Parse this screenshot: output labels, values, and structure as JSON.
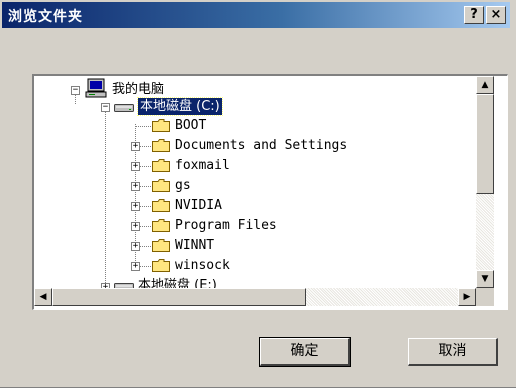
{
  "window": {
    "title": "浏览文件夹",
    "help_button": "?",
    "close_button": "×"
  },
  "tree": {
    "root": {
      "label": "我的电脑",
      "expander": "−"
    },
    "drive_c": {
      "label": "本地磁盘 (C:)",
      "expander": "−",
      "selected": true
    },
    "folders": [
      {
        "label": "BOOT",
        "expander": ""
      },
      {
        "label": "Documents and Settings",
        "expander": "+"
      },
      {
        "label": "foxmail",
        "expander": "+"
      },
      {
        "label": "gs",
        "expander": "+"
      },
      {
        "label": "NVIDIA",
        "expander": "+"
      },
      {
        "label": "Program Files",
        "expander": "+"
      },
      {
        "label": "WINNT",
        "expander": "+"
      },
      {
        "label": "winsock",
        "expander": "+"
      }
    ],
    "drive_e": {
      "label": "本地磁盘 (E:)",
      "expander": "+"
    }
  },
  "scrollbars": {
    "up_arrow": "▲",
    "down_arrow": "▼",
    "left_arrow": "◀",
    "right_arrow": "▶"
  },
  "buttons": {
    "ok": "确定",
    "cancel": "取消"
  },
  "colors": {
    "titlebar_start": "#0a246a",
    "titlebar_end": "#a6caf0",
    "selection": "#0a246a",
    "face": "#d4d0c8",
    "folder_yellow": "#ffe680"
  },
  "icons": {
    "computer": "computer-icon",
    "drive": "hard-drive-icon",
    "folder": "folder-icon"
  }
}
